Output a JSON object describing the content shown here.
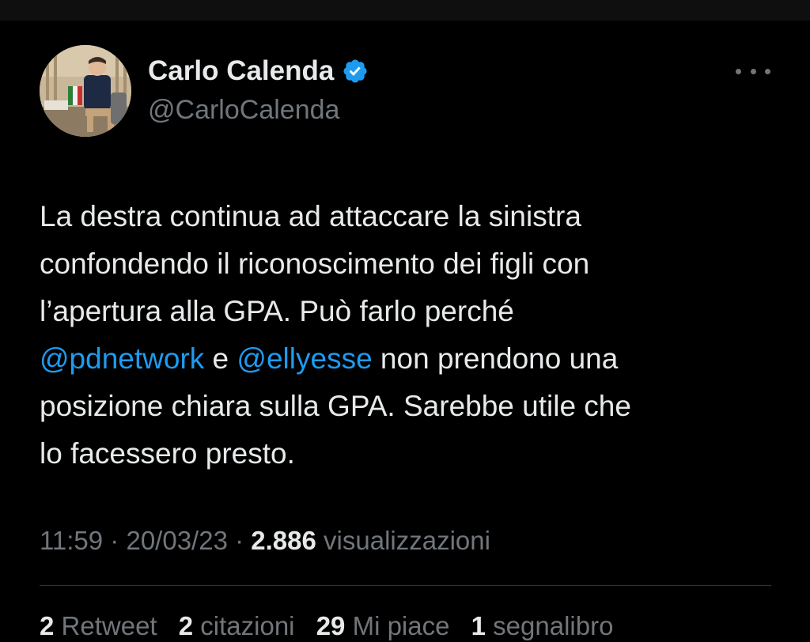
{
  "tweet": {
    "author": {
      "display_name": "Carlo Calenda",
      "handle": "@CarloCalenda",
      "verified": true
    },
    "body": {
      "line1": "La destra continua ad attaccare la sinistra",
      "line2": "confondendo il riconoscimento dei figli con",
      "line3": "l’apertura alla GPA. Può farlo perché",
      "mention1": "@pdnetwork",
      "connector": " e ",
      "mention2": "@ellyesse",
      "line4_rest": " non prendono una",
      "line5": "posizione chiara sulla GPA. Sarebbe utile che",
      "line6": "lo facessero presto."
    },
    "meta": {
      "time": "11:59",
      "separator": " · ",
      "date": "20/03/23",
      "views_count": "2.886",
      "views_label": " visualizzazioni"
    },
    "stats": {
      "retweets_count": "2",
      "retweets_label": " Retweet",
      "quotes_count": "2",
      "quotes_label": " citazioni",
      "likes_count": "29",
      "likes_label": " Mi piace",
      "bookmarks_count": "1",
      "bookmarks_label": " segnalibro"
    }
  },
  "icons": {
    "verified": "verified-badge-icon",
    "more": "more-horizontal-icon"
  },
  "colors": {
    "background": "#000000",
    "text_primary": "#e7e9ea",
    "text_secondary": "#71767b",
    "accent": "#1d9bf0",
    "divider": "#2f3336"
  }
}
